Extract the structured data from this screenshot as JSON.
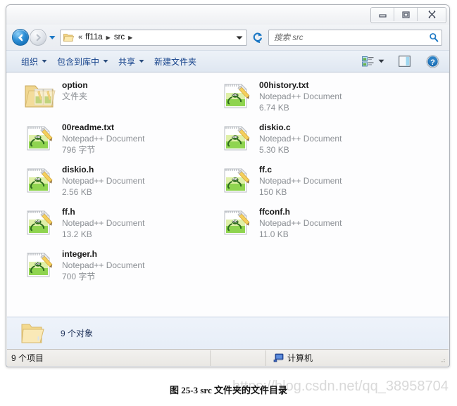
{
  "window": {
    "controls": {
      "minimize_label": "minimize",
      "maximize_label": "maximize",
      "close_label": "close"
    }
  },
  "address_bar": {
    "back_label": "back",
    "forward_label": "forward",
    "history_label": "recent pages",
    "breadcrumb_prefix": "«",
    "crumbs": [
      "ff11a",
      "src"
    ],
    "refresh_label": "refresh",
    "dropdown_label": "previous locations"
  },
  "search": {
    "placeholder": "搜索 src",
    "icon": "search-icon"
  },
  "toolbar": {
    "items": [
      {
        "label": "组织",
        "caret": true
      },
      {
        "label": "包含到库中",
        "caret": true
      },
      {
        "label": "共享",
        "caret": true
      },
      {
        "label": "新建文件夹",
        "caret": false
      }
    ],
    "view_options_label": "view-options",
    "preview_pane_label": "preview-pane",
    "help_label": "help"
  },
  "files": {
    "left_column": [
      {
        "name": "option",
        "type": "文件夹",
        "size": "",
        "icon": "folder-icon"
      },
      {
        "name": "00readme.txt",
        "type": "Notepad++ Document",
        "size": "796 字节",
        "icon": "notepadpp-file-icon"
      },
      {
        "name": "diskio.h",
        "type": "Notepad++ Document",
        "size": "2.56 KB",
        "icon": "notepadpp-file-icon"
      },
      {
        "name": "ff.h",
        "type": "Notepad++ Document",
        "size": "13.2 KB",
        "icon": "notepadpp-file-icon"
      },
      {
        "name": "integer.h",
        "type": "Notepad++ Document",
        "size": "700 字节",
        "icon": "notepadpp-file-icon"
      }
    ],
    "right_column": [
      {
        "name": "00history.txt",
        "type": "Notepad++ Document",
        "size": "6.74 KB",
        "icon": "notepadpp-file-icon"
      },
      {
        "name": "diskio.c",
        "type": "Notepad++ Document",
        "size": "5.30 KB",
        "icon": "notepadpp-file-icon"
      },
      {
        "name": "ff.c",
        "type": "Notepad++ Document",
        "size": "150 KB",
        "icon": "notepadpp-file-icon"
      },
      {
        "name": "ffconf.h",
        "type": "Notepad++ Document",
        "size": "11.0 KB",
        "icon": "notepadpp-file-icon"
      }
    ]
  },
  "details_pane": {
    "icon": "open-folder-icon",
    "text": "9 个对象"
  },
  "status_bar": {
    "items_text": "9 个项目",
    "location_icon": "computer-icon",
    "location_text": "计算机"
  },
  "caption": {
    "text": "图 25-3 src 文件夹的文件目录"
  },
  "watermark": {
    "text": "https://blog.csdn.net/qq_38958704"
  },
  "colors": {
    "accent_blue": "#15428b",
    "crumb_text": "#111111",
    "meta_gray": "#8b8f94",
    "details_bg": "#e7eef8"
  }
}
